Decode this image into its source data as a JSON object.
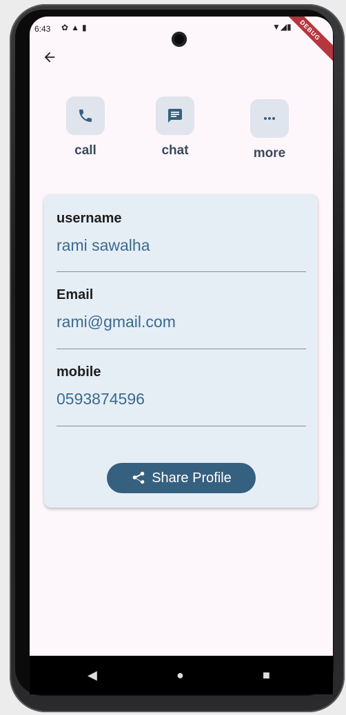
{
  "status_bar": {
    "time": "6:43",
    "left_icons": [
      "settings-icon",
      "warning-icon",
      "sim-icon"
    ],
    "right_icons": [
      "wifi-icon",
      "signal-icon",
      "battery-icon"
    ],
    "debug_banner": "DEBUG"
  },
  "actions": [
    {
      "label": "call",
      "icon": "phone-icon"
    },
    {
      "label": "chat",
      "icon": "chat-icon"
    },
    {
      "label": "more",
      "icon": "more-icon"
    }
  ],
  "profile": {
    "fields": [
      {
        "label": "username",
        "value": "rami sawalha"
      },
      {
        "label": "Email",
        "value": "rami@gmail.com"
      },
      {
        "label": "mobile",
        "value": "0593874596"
      }
    ],
    "share_label": "Share Profile"
  },
  "colors": {
    "screen_bg": "#fdf6fb",
    "card_bg": "#e6eef5",
    "accent": "#36607f",
    "value_text": "#3a6a90",
    "icon_box": "#e0e4ec"
  }
}
